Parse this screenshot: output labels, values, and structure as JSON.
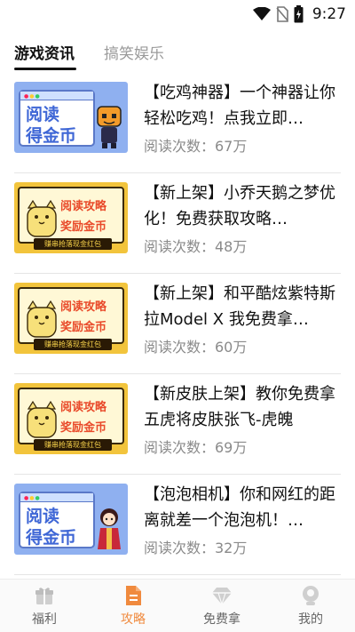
{
  "status_bar": {
    "time": "9:27"
  },
  "tabs": [
    {
      "label": "游戏资讯",
      "active": true
    },
    {
      "label": "搞笑娱乐",
      "active": false
    }
  ],
  "thumbnail_texts": {
    "blue_line1": "阅读",
    "blue_line2": "得金币",
    "yellow_line1": "阅读攻略",
    "yellow_line2": "奖励金币",
    "yellow_ribbon": "赚串抢落现金红包"
  },
  "articles": [
    {
      "title": "【吃鸡神器】一个神器让你轻松吃鸡！点我立即…",
      "reads": "阅读次数：67万",
      "thumb": "blue"
    },
    {
      "title": "【新上架】小乔天鹅之梦优化！免费获取攻略…",
      "reads": "阅读次数：48万",
      "thumb": "yellow"
    },
    {
      "title": "【新上架】和平酷炫紫特斯拉Model X 我免费拿…",
      "reads": "阅读次数：60万",
      "thumb": "yellow"
    },
    {
      "title": "【新皮肤上架】教你免费拿五虎将皮肤张飞-虎魄",
      "reads": "阅读次数：69万",
      "thumb": "yellow"
    },
    {
      "title": "【泡泡相机】你和网红的距离就差一个泡泡机！…",
      "reads": "阅读次数：32万",
      "thumb": "blue"
    }
  ],
  "bottom_nav": [
    {
      "label": "福利",
      "icon": "gift-icon",
      "active": false
    },
    {
      "label": "攻略",
      "icon": "document-icon",
      "active": true
    },
    {
      "label": "免费拿",
      "icon": "diamond-icon",
      "active": false
    },
    {
      "label": "我的",
      "icon": "profile-icon",
      "active": false
    }
  ],
  "colors": {
    "accent": "#f08a3e",
    "inactive": "#cccccc",
    "blue_card": "#8fb0f0",
    "yellow_card": "#f2c43c"
  }
}
